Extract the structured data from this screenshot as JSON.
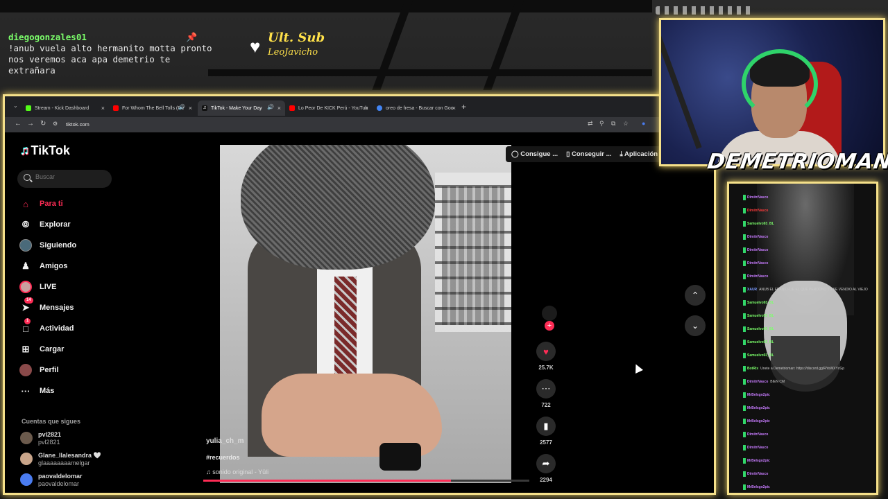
{
  "overlay_chat": {
    "username": "diegogonzales01",
    "message": "!anub vuela alto hermanito motta pronto nos veremos aca apa demetrio te extrañara"
  },
  "sub_badge": {
    "title": "Ult. Sub",
    "name": "LeoJavicho"
  },
  "browser": {
    "tabs": [
      {
        "label": "Stream - Kick Dashboard",
        "color": "#53fc18",
        "active": false
      },
      {
        "label": "For Whom The Bell Tolls (Re",
        "color": "#ff0000",
        "active": false,
        "sound": true
      },
      {
        "label": "TikTok - Make Your Day",
        "color": "#ffffff",
        "active": true,
        "sound": true
      },
      {
        "label": "Lo Peor De KICK Perú - YouTub",
        "color": "#ff0000",
        "active": false
      },
      {
        "label": "oreo de fresa - Buscar con Goo",
        "color": "#4285f4",
        "active": false
      }
    ],
    "url": "tiktok.com"
  },
  "tiktok": {
    "brand": "TikTok",
    "search_placeholder": "Buscar",
    "nav": [
      {
        "label": "Para ti",
        "icon": "home-icon",
        "active": true
      },
      {
        "label": "Explorar",
        "icon": "compass-icon"
      },
      {
        "label": "Siguiendo",
        "icon": "following-avatar-icon"
      },
      {
        "label": "Amigos",
        "icon": "friends-icon"
      },
      {
        "label": "LIVE",
        "icon": "live-icon"
      },
      {
        "label": "Mensajes",
        "icon": "send-icon",
        "badge": "14"
      },
      {
        "label": "Actividad",
        "icon": "activity-icon",
        "badge": "1"
      },
      {
        "label": "Cargar",
        "icon": "upload-icon"
      },
      {
        "label": "Perfil",
        "icon": "profile-icon"
      },
      {
        "label": "Más",
        "icon": "more-icon"
      }
    ],
    "following_title": "Cuentas que sigues",
    "following": [
      {
        "name": "pvl2821",
        "handle": "pvl2821"
      },
      {
        "name": "Glane_llalesandra 🤍",
        "handle": "glaaaaaaaamelgar"
      },
      {
        "name": "paovaldelomar",
        "handle": "paovaldelomar"
      }
    ],
    "top_actions": [
      "Consigue ...",
      "Conseguir ...",
      "Aplicación"
    ],
    "video": {
      "author": "yulia_ch_m",
      "hashtag": "#recuerdos",
      "sound": "sonido original - Yüli",
      "progress": 0.76
    },
    "stats": {
      "likes": "25.7K",
      "comments": "722",
      "saves": "2577",
      "shares": "2294"
    }
  },
  "streamer_banner": "DEMETRIOMAN",
  "stream_chat_lines": [
    {
      "user": "DimitriVasco",
      "color": "#c87cff"
    },
    {
      "user": "DimitriVasco",
      "color": "#ff3b3b"
    },
    {
      "user": "Samuelvo93_BL",
      "color": "#7cff6b"
    },
    {
      "user": "DimitriVasco",
      "color": "#c87cff"
    },
    {
      "user": "DimitriVasco",
      "color": "#c87cff"
    },
    {
      "user": "DimitriVasco",
      "color": "#c87cff"
    },
    {
      "user": "DimitriVasco",
      "color": "#c87cff"
    },
    {
      "user": "XAUR",
      "color": "#7c9cff",
      "msg": "ANUB EL FRANK FUE EL QUE PERDONO TU SE VENDIO AL VIEJO"
    },
    {
      "user": "Samuelvo93_BL",
      "color": "#7cff6b"
    },
    {
      "user": "Samuelvo93_BL",
      "color": "#7cff6b"
    },
    {
      "user": "Samuelvo93_BL",
      "color": "#7cff6b"
    },
    {
      "user": "Samuelvo93_BL",
      "color": "#7cff6b"
    },
    {
      "user": "Samuelvo93_BL",
      "color": "#7cff6b"
    },
    {
      "user": "BotRix",
      "color": "#7cff6b",
      "msg": "Unete a Demetrioman: https://discord.gg/RYoWXYcGp"
    },
    {
      "user": "DimitriVasco",
      "color": "#c87cff",
      "msg": "BIEN CM"
    },
    {
      "user": "MrBelsgo2pic",
      "color": "#c87cff"
    },
    {
      "user": "MrBelsgo2pic",
      "color": "#c87cff"
    },
    {
      "user": "MrBelsgo2pic",
      "color": "#c87cff"
    },
    {
      "user": "DimitriVasco",
      "color": "#c87cff"
    },
    {
      "user": "DimitriVasco",
      "color": "#c87cff"
    },
    {
      "user": "MrBelsgo2pic",
      "color": "#c87cff"
    },
    {
      "user": "DimitriVasco",
      "color": "#c87cff"
    },
    {
      "user": "MrBelsgo2pic",
      "color": "#c87cff"
    },
    {
      "user": "DimitriVasco",
      "color": "#c87cff"
    }
  ],
  "colors": {
    "accent": "#fe2c55",
    "frame": "#f5e08a",
    "sidebar_bg": "#000000"
  }
}
